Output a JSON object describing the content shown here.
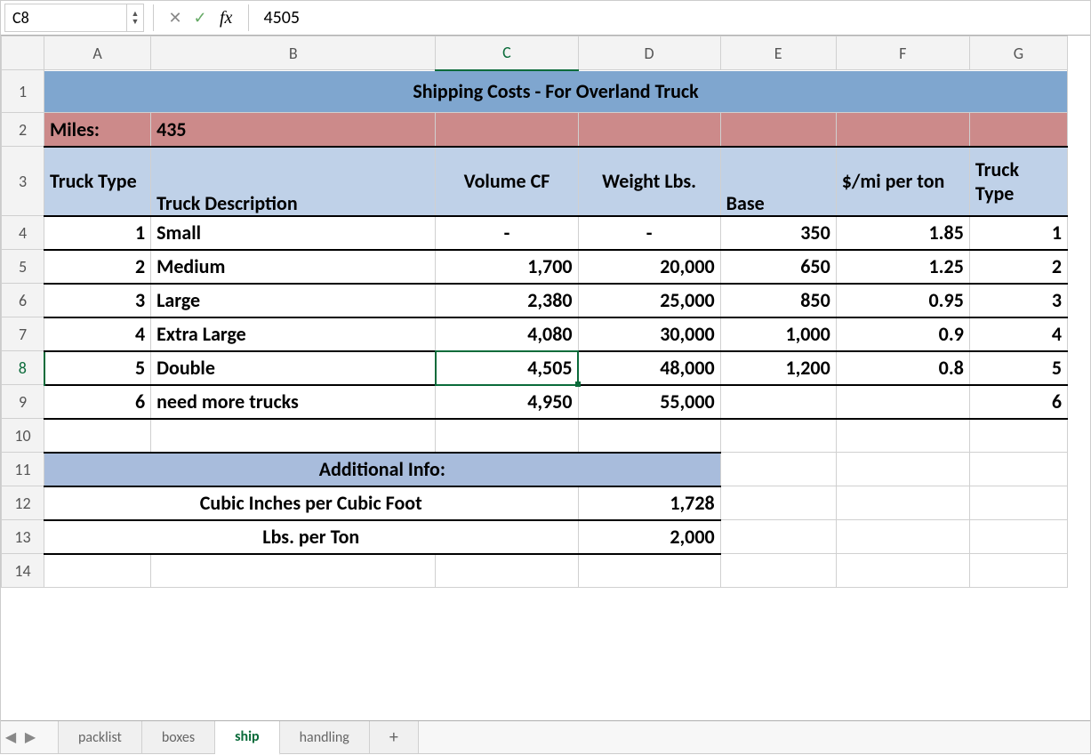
{
  "namebox": "C8",
  "formula_label": "fx",
  "formula_value": "4505",
  "columns": [
    "A",
    "B",
    "C",
    "D",
    "E",
    "F",
    "G"
  ],
  "rows": [
    "1",
    "2",
    "3",
    "4",
    "5",
    "6",
    "7",
    "8",
    "9",
    "10",
    "11",
    "12",
    "13",
    "14"
  ],
  "title": "Shipping Costs - For Overland Truck",
  "miles_label": "Miles:",
  "miles_value": "435",
  "headers": {
    "a": "Truck Type",
    "b": "Truck Description",
    "c": "Volume CF",
    "d": "Weight Lbs.",
    "e": "Base",
    "f": "$/mi per ton",
    "g": "Truck Type"
  },
  "trucks": [
    {
      "n": "1",
      "desc": "Small",
      "vol": "-",
      "wt": "-",
      "base": "350",
      "rate": "1.85",
      "t": "1"
    },
    {
      "n": "2",
      "desc": "Medium",
      "vol": "1,700",
      "wt": "20,000",
      "base": "650",
      "rate": "1.25",
      "t": "2"
    },
    {
      "n": "3",
      "desc": "Large",
      "vol": "2,380",
      "wt": "25,000",
      "base": "850",
      "rate": "0.95",
      "t": "3"
    },
    {
      "n": "4",
      "desc": "Extra Large",
      "vol": "4,080",
      "wt": "30,000",
      "base": "1,000",
      "rate": "0.9",
      "t": "4"
    },
    {
      "n": "5",
      "desc": "Double",
      "vol": "4,505",
      "wt": "48,000",
      "base": "1,200",
      "rate": "0.8",
      "t": "5"
    },
    {
      "n": "6",
      "desc": "need more trucks",
      "vol": "4,950",
      "wt": "55,000",
      "base": "",
      "rate": "",
      "t": "6"
    }
  ],
  "add_info_title": "Additional Info:",
  "cubic_label": "Cubic Inches per Cubic Foot",
  "cubic_value": "1,728",
  "ton_label": "Lbs. per Ton",
  "ton_value": "2,000",
  "tabs": [
    "packlist",
    "boxes",
    "ship",
    "handling"
  ],
  "active_tab": "ship",
  "add_tab": "+",
  "selected_cell": "C8",
  "chart_data": {
    "type": "table",
    "title": "Shipping Costs - For Overland Truck",
    "miles": 435,
    "columns": [
      "Truck Type",
      "Truck Description",
      "Volume CF",
      "Weight Lbs.",
      "Base",
      "$/mi per ton",
      "Truck Type"
    ],
    "rows": [
      [
        1,
        "Small",
        null,
        null,
        350,
        1.85,
        1
      ],
      [
        2,
        "Medium",
        1700,
        20000,
        650,
        1.25,
        2
      ],
      [
        3,
        "Large",
        2380,
        25000,
        850,
        0.95,
        3
      ],
      [
        4,
        "Extra Large",
        4080,
        30000,
        1000,
        0.9,
        4
      ],
      [
        5,
        "Double",
        4505,
        48000,
        1200,
        0.8,
        5
      ],
      [
        6,
        "need more trucks",
        4950,
        55000,
        null,
        null,
        6
      ]
    ],
    "additional": {
      "Cubic Inches per Cubic Foot": 1728,
      "Lbs. per Ton": 2000
    }
  }
}
